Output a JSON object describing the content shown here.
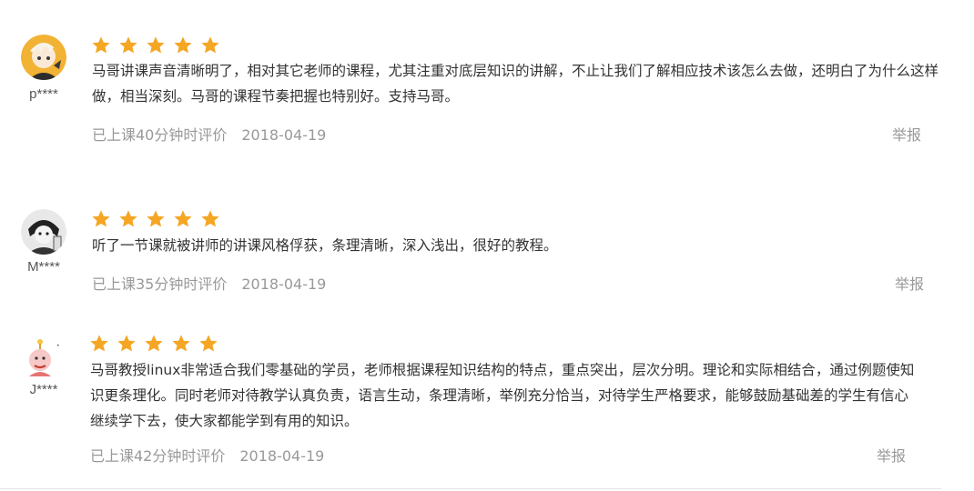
{
  "reviews": [
    {
      "user": "p****",
      "text": "马哥讲课声音清晰明了，相对其它老师的课程，尤其注重对底层知识的讲解，不止让我们了解相应技术该怎么去做，还明白了为什么这样做，相当深刻。马哥的课程节奏把握也特别好。支持马哥。",
      "time": "已上课40分钟时评价",
      "date": "2018-04-19",
      "report": "举报",
      "rating": 5
    },
    {
      "user": "M****",
      "text": "听了一节课就被讲师的讲课风格俘获，条理清晰，深入浅出，很好的教程。",
      "time": "已上课35分钟时评价",
      "date": "2018-04-19",
      "report": "举报",
      "rating": 5
    },
    {
      "user": "J****",
      "text": "马哥教授linux非常适合我们零基础的学员，老师根据课程知识结构的特点，重点突出，层次分明。理论和实际相结合，通过例题使知识更条理化。同时老师对待教学认真负责，语言生动，条理清晰，举例充分恰当，对待学生严格要求，能够鼓励基础差的学生有信心继续学下去，使大家都能学到有用的知识。",
      "time": "已上课42分钟时评价",
      "date": "2018-04-19",
      "report": "举报",
      "rating": 5
    }
  ],
  "colors": {
    "star": "#f5a623",
    "meta": "#999999",
    "text": "#333333"
  }
}
